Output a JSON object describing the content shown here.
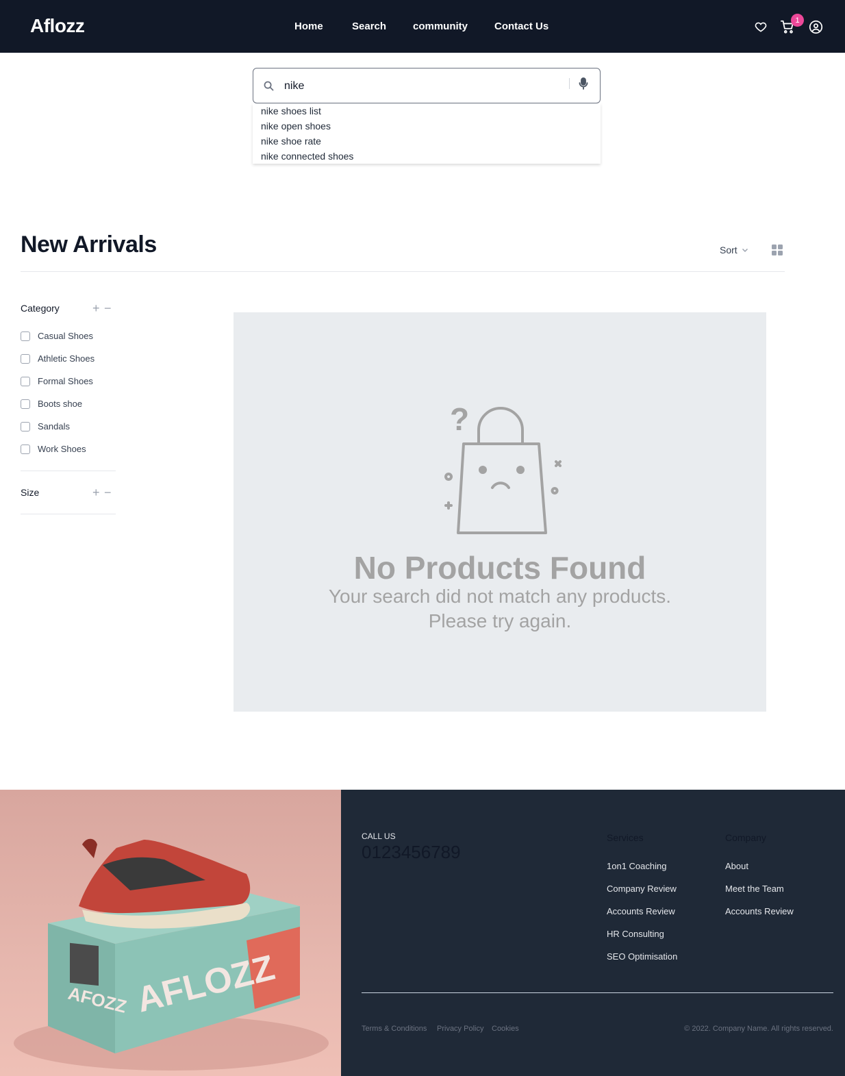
{
  "header": {
    "logo": "Aflozz",
    "nav": [
      "Home",
      "Search",
      "community",
      "Contact Us"
    ],
    "cart_count": "1"
  },
  "search": {
    "value": "nike",
    "suggestions": [
      "nike shoes list",
      "nike open shoes",
      "nike shoe rate",
      "nike connected shoes"
    ]
  },
  "main": {
    "title": "New Arrivals",
    "sort_label": "Sort"
  },
  "filters": {
    "category_label": "Category",
    "categories": [
      "Casual Shoes",
      "Athletic Shoes",
      "Formal Shoes",
      "Boots shoe",
      "Sandals",
      "Work Shoes"
    ],
    "size_label": "Size"
  },
  "empty_state": {
    "title": "No Products Found",
    "line1": "Your search did not match any products.",
    "line2": "Please try again."
  },
  "footer": {
    "call_label": "CALL US",
    "phone": "0123456789",
    "services_heading": "Services",
    "services": [
      "1on1 Coaching",
      "Company Review",
      "Accounts Review",
      "HR Consulting",
      "SEO Optimisation"
    ],
    "company_heading": "Company",
    "company": [
      "About",
      "Meet the Team",
      "Accounts Review"
    ],
    "legal_links": [
      "Terms & Conditions",
      "Privacy Policy",
      "Cookies"
    ],
    "copyright": "© 2022. Company Name. All rights reserved.",
    "box_brand": "AFLOZZ",
    "box_brand_side": "AFOZZ"
  },
  "colors": {
    "header_bg": "#111827",
    "footer_bg": "#1f2937",
    "badge": "#ec4899",
    "empty_panel": "#e9ecef"
  }
}
